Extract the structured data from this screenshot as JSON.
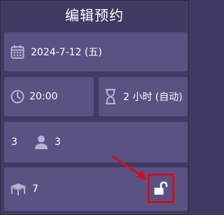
{
  "header": {
    "title": "编辑预约"
  },
  "date": {
    "value": "2024-7-12 (五)",
    "icon": "calendar-icon"
  },
  "time": {
    "value": "20:00",
    "icon": "clock-icon"
  },
  "duration": {
    "value": "2 小时 (自动)",
    "icon": "hourglass-icon"
  },
  "counts": {
    "first": "3",
    "guests": "3",
    "icon": "person-icon"
  },
  "table": {
    "value": "7",
    "icon": "table-icon",
    "lock_icon": "unlock-icon"
  },
  "colors": {
    "background": "#413a63",
    "card": "#5a5283",
    "icon": "#b7b2d1",
    "highlight": "#d0101a"
  }
}
